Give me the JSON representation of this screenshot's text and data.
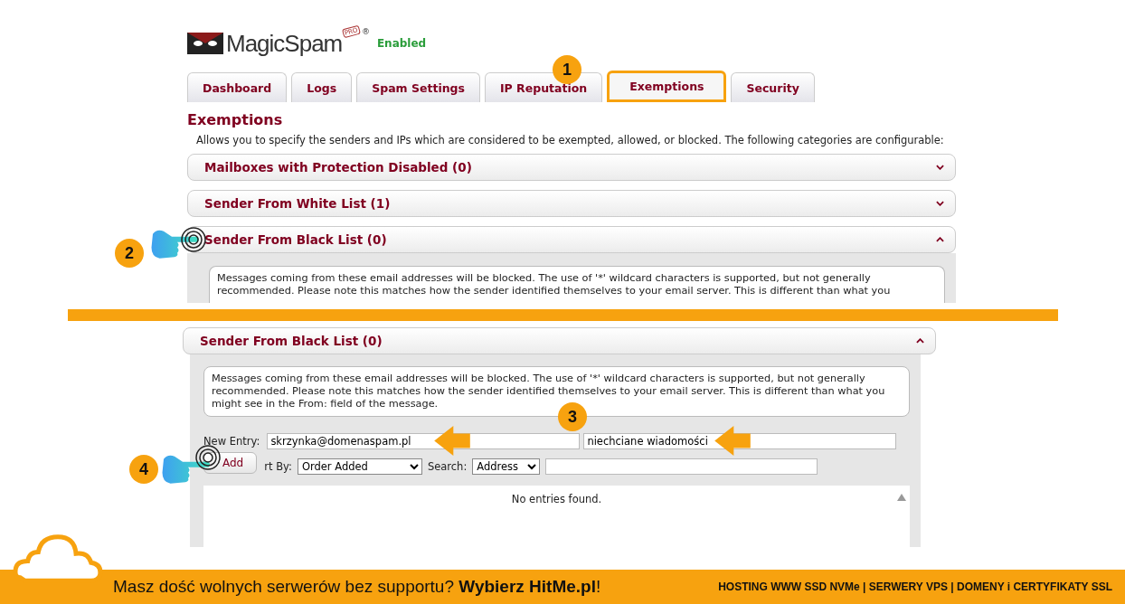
{
  "header": {
    "logo": "MagicSpam",
    "logo_badge": "PRO",
    "logo_mark": "®",
    "status": "Enabled"
  },
  "tabs": [
    {
      "label": "Dashboard",
      "selected": false
    },
    {
      "label": "Logs",
      "selected": false
    },
    {
      "label": "Spam Settings",
      "selected": false
    },
    {
      "label": "IP Reputation",
      "selected": false
    },
    {
      "label": "Exemptions",
      "selected": true
    },
    {
      "label": "Security",
      "selected": false
    }
  ],
  "heading": "Exemptions",
  "intro": "Allows you to specify the senders and IPs which are considered to be exempted, allowed, or blocked. The following categories are configurable:",
  "sections": [
    {
      "title": "Mailboxes with Protection Disabled (0)",
      "expanded": false
    },
    {
      "title": "Sender From White List (1)",
      "expanded": false
    },
    {
      "title": "Sender From Black List (0)",
      "expanded": true,
      "description": "Messages coming from these email addresses will be blocked. The use of '*' wildcard characters is supported, but not generally recommended. Please note this matches how the sender identified themselves to your email server. This is different than what you"
    }
  ],
  "detail": {
    "title": "Sender From Black List (0)",
    "expanded": true,
    "description": "Messages coming from these email addresses will be blocked. The use of '*' wildcard characters is supported, but not generally recommended. Please note this matches how the sender identified themselves to your email server. This is different than what you might see in the From: field of the message.",
    "new_entry_label": "New Entry:",
    "entry_value": "skrzynka@domenaspam.pl",
    "comment_value": "niechciane wiadomości",
    "add_button": "Add",
    "sort_label": "rt By:",
    "sort_value": "Order Added",
    "search_label": "Search:",
    "search_field": "Address",
    "empty": "No entries found."
  },
  "callouts": [
    "1",
    "2",
    "3",
    "4"
  ],
  "banner": {
    "text": "Masz dość wolnych serwerów bez supportu? **Wybierz HitMe.pl**!",
    "services": "HOSTING WWW SSD NVMe | SERWERY VPS | DOMENY i CERTYFIKATY SSL"
  }
}
